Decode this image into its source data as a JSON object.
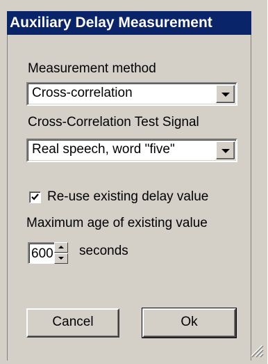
{
  "dialog": {
    "title": "Auxiliary Delay Measurement"
  },
  "measurement_method": {
    "label": "Measurement method",
    "value": "Cross-correlation"
  },
  "test_signal": {
    "label": "Cross-Correlation  Test Signal",
    "value": "Real speech, word \"five\""
  },
  "reuse_delay": {
    "label": "Re-use existing delay value",
    "checked": true
  },
  "max_age": {
    "label": "Maximum age of existing value",
    "value": "600",
    "unit": "seconds"
  },
  "buttons": {
    "cancel": "Cancel",
    "ok": "Ok"
  },
  "icons": {
    "dropdown": "chevron-down-icon",
    "check": "check-icon",
    "spin_up": "arrow-up-icon",
    "spin_down": "arrow-down-icon",
    "resize": "resize-grip-icon"
  },
  "colors": {
    "title_bar": "#0a246a",
    "face": "#d4d0c8"
  }
}
